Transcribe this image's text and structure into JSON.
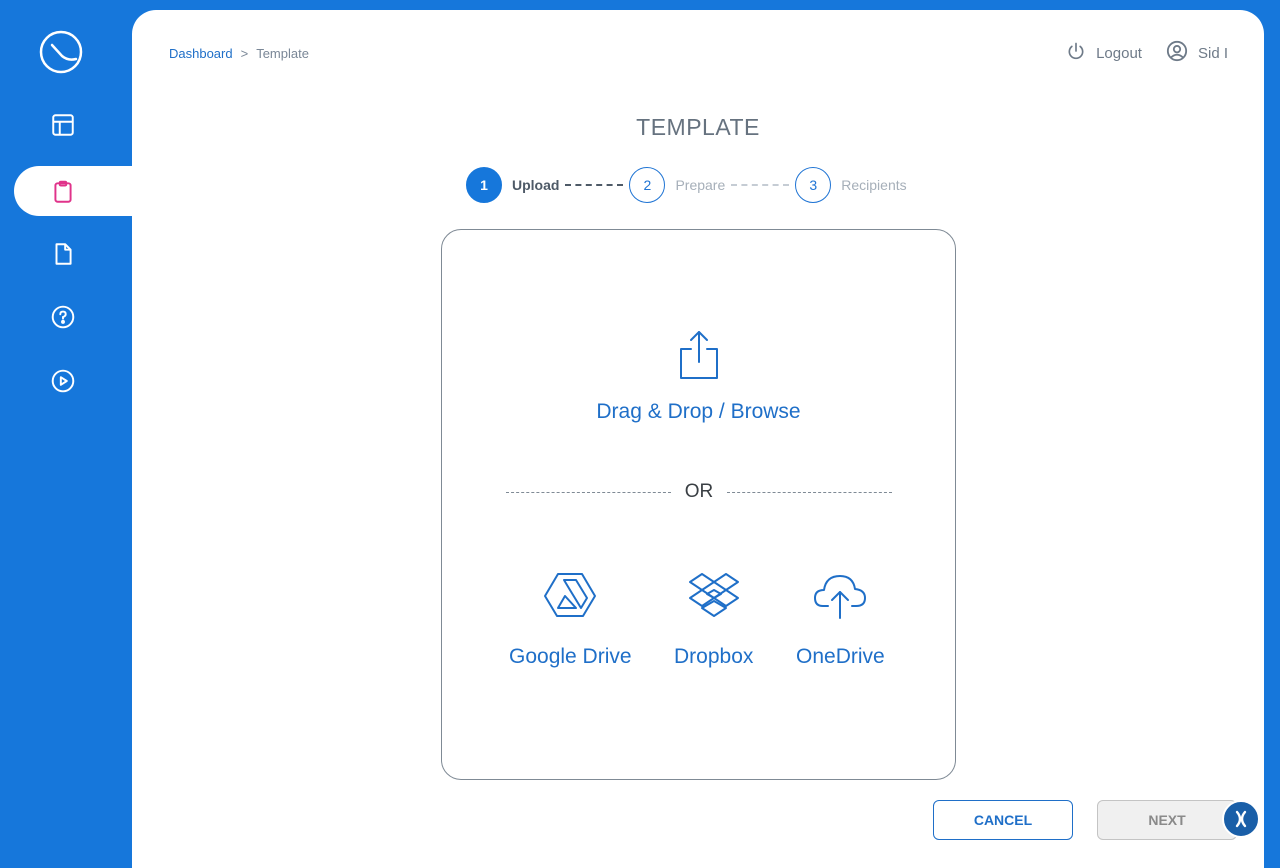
{
  "sidebar": {
    "logo_icon": "brand-logo-icon",
    "items": [
      {
        "icon": "dashboard-layout-icon",
        "active": false
      },
      {
        "icon": "clipboard-icon",
        "active": true
      },
      {
        "icon": "document-icon",
        "active": false
      },
      {
        "icon": "help-circle-icon",
        "active": false
      },
      {
        "icon": "play-circle-icon",
        "active": false
      }
    ],
    "active_color": "#e0338a"
  },
  "breadcrumb": {
    "home": "Dashboard",
    "separator": ">",
    "current": "Template"
  },
  "header": {
    "logout_label": "Logout",
    "user_name": "Sid I"
  },
  "page": {
    "title": "TEMPLATE"
  },
  "steps": [
    {
      "number": "1",
      "label": "Upload",
      "active": true
    },
    {
      "number": "2",
      "label": "Prepare",
      "active": false
    },
    {
      "number": "3",
      "label": "Recipients",
      "active": false
    }
  ],
  "upload": {
    "drag_label": "Drag & Drop / Browse",
    "or_label": "OR",
    "sources": [
      {
        "label": "Google Drive",
        "icon": "google-drive-icon"
      },
      {
        "label": "Dropbox",
        "icon": "dropbox-icon"
      },
      {
        "label": "OneDrive",
        "icon": "onedrive-cloud-icon"
      }
    ]
  },
  "actions": {
    "cancel_label": "CANCEL",
    "next_label": "NEXT"
  },
  "colors": {
    "brand_blue": "#1677db",
    "link_blue": "#1f6fc8",
    "active_pink": "#e0338a"
  }
}
